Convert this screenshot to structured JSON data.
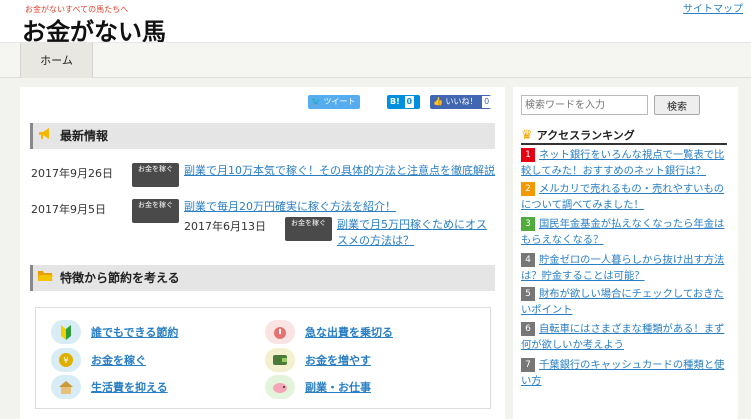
{
  "header": {
    "tagline": "お金がないすべての馬たちへ",
    "site_title": "お金がない馬",
    "sitemap": "サイトマップ"
  },
  "nav": {
    "home": "ホーム"
  },
  "social": {
    "tweet": "ツイート",
    "hatena": "B!",
    "hatena_count": "0",
    "like": "いいね！",
    "like_count": "0"
  },
  "news": {
    "heading": "最新情報",
    "items": [
      {
        "date": "2017年9月26日",
        "tag": "お金を稼ぐ",
        "title": "副業で月10万本気で稼ぐ！その具体的方法と注意点を徹底解説"
      },
      {
        "date": "2017年9月5日",
        "tag": "お金を稼ぐ",
        "title": "副業で毎月20万円確実に稼ぐ方法を紹介！"
      },
      {
        "date": "2017年6月13日",
        "tag": "お金を稼ぐ",
        "title": "副業で月5万円稼ぐためにオススメの方法は？"
      }
    ]
  },
  "features": {
    "heading": "特徴から節約を考える",
    "items": [
      {
        "label": "誰でもできる節約",
        "icon": "beginner-leaf-icon"
      },
      {
        "label": "急な出費を乗切る",
        "icon": "emergency-icon"
      },
      {
        "label": "お金を稼ぐ",
        "icon": "coin-icon"
      },
      {
        "label": "お金を増やす",
        "icon": "wallet-icon"
      },
      {
        "label": "生活費を抑える",
        "icon": "house-icon"
      },
      {
        "label": "副業・お仕事",
        "icon": "piggy-bank-icon"
      }
    ]
  },
  "sidebar": {
    "search_placeholder": "検索ワードを入力",
    "search_button": "検索",
    "ranking_heading": "アクセスランキング",
    "ranking": [
      {
        "num": "1",
        "color": "#e60012",
        "text": "ネット銀行をいろんな視点で一覧表で比較してみた！おすすめのネット銀行は？"
      },
      {
        "num": "2",
        "color": "#f39800",
        "text": "メルカリで売れるもの・売れやすいものについて調べてみました！"
      },
      {
        "num": "3",
        "color": "#4fac3c",
        "text": "国民年金基金が払えなくなったら年金はもらえなくなる？"
      },
      {
        "num": "4",
        "color": "#777777",
        "text": "貯金ゼロの一人暮らしから抜け出す方法は？貯金することは可能？"
      },
      {
        "num": "5",
        "color": "#777777",
        "text": "財布が欲しい場合にチェックしておきたいポイント"
      },
      {
        "num": "6",
        "color": "#777777",
        "text": "自転車にはさまざまな種類がある！まず何が欲しいか考えよう"
      },
      {
        "num": "7",
        "color": "#777777",
        "text": "千葉銀行のキャッシュカードの種類と使い方"
      }
    ]
  }
}
